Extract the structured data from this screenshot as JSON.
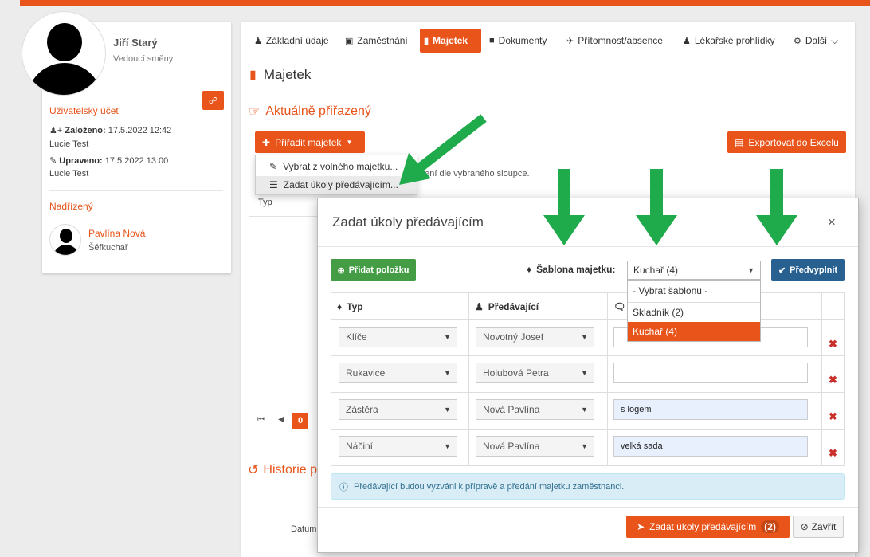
{
  "colors": {
    "accent": "#e8541a",
    "green_arrow": "#1faa4b",
    "primary": "#286090",
    "success": "#449d44",
    "danger": "#c9302c"
  },
  "profile": {
    "name": "Jiří Starý",
    "role": "Vedoucí směny",
    "account_title": "Uživatelský účet",
    "created_label": "Založeno:",
    "created_value": "17.5.2022 12:42",
    "created_by": "Lucie Test",
    "updated_label": "Upraveno:",
    "updated_value": "17.5.2022 13:00",
    "updated_by": "Lucie Test",
    "supervisor_title": "Nadřízený",
    "supervisor_name": "Pavlína Nová",
    "supervisor_role": "Šéfkuchař"
  },
  "tabs": [
    {
      "label": "Základní údaje",
      "icon": "user-icon"
    },
    {
      "label": "Zaměstnání",
      "icon": "briefcase-icon"
    },
    {
      "label": "Majetek",
      "icon": "book-icon"
    },
    {
      "label": "Dokumenty",
      "icon": "file-icon"
    },
    {
      "label": "Přítomnost/absence",
      "icon": "plane-icon"
    },
    {
      "label": "Lékařské prohlídky",
      "icon": "user-md-icon"
    },
    {
      "label": "Další",
      "icon": "cogs-icon"
    }
  ],
  "page": {
    "title": "Majetek",
    "assigned_title": "Aktuálně přiřazený",
    "assign_button": "Přiřadit majetek",
    "export_button": "Exportovat do Excelu",
    "menu": [
      "Vybrat z volného majetku...",
      "Zadat úkoly předávajícím..."
    ],
    "hint": "pení dle vybraného sloupce.",
    "col_typ": "Typ",
    "pager_page": "0",
    "history_title": "Historie p",
    "history_col": "Datum"
  },
  "modal": {
    "title": "Zadat úkoly předávajícím",
    "close_glyph": "×",
    "add_item": "Přidat položku",
    "template_label": "Šablona majetku:",
    "template_value": "Kuchař (4)",
    "prefill": "Předvyplnit",
    "template_options": [
      "- Vybrat šablonu -",
      "Skladník (2)",
      "Kuchař (4)"
    ],
    "template_selected_index": 2,
    "col_typ": "Typ",
    "col_giver": "Předávající",
    "rows": [
      {
        "type": "Klíče",
        "giver": "Novotný Josef",
        "note": ""
      },
      {
        "type": "Rukavice",
        "giver": "Holubová Petra",
        "note": ""
      },
      {
        "type": "Zástěra",
        "giver": "Nová Pavlína",
        "note": "s logem"
      },
      {
        "type": "Náčiní",
        "giver": "Nová Pavlína",
        "note": "velká sada"
      }
    ],
    "info": "Předávající budou vyzváni k přípravě a předání majetku zaměstnanci.",
    "submit": "Zadat úkoly předávajícím",
    "submit_count": "(2)",
    "close_button": "Zavřít"
  }
}
